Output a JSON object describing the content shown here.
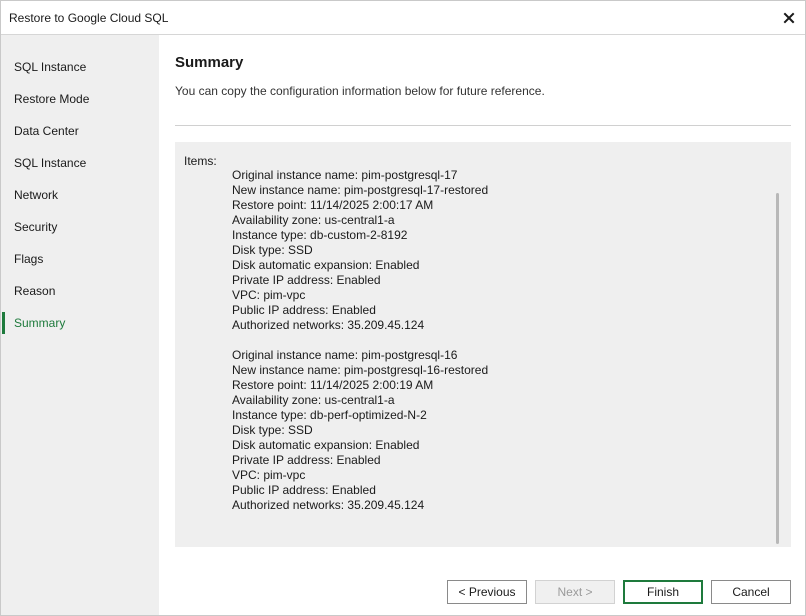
{
  "window": {
    "title": "Restore to Google Cloud SQL"
  },
  "sidebar": {
    "items": [
      {
        "label": "SQL Instance"
      },
      {
        "label": "Restore Mode"
      },
      {
        "label": "Data Center"
      },
      {
        "label": "SQL Instance"
      },
      {
        "label": "Network"
      },
      {
        "label": "Security"
      },
      {
        "label": "Flags"
      },
      {
        "label": "Reason"
      },
      {
        "label": "Summary"
      }
    ],
    "active_index": 8
  },
  "page": {
    "title": "Summary",
    "description": "You can copy the configuration information below for future reference."
  },
  "summary": {
    "items_label": "Items:",
    "instances": [
      {
        "lines": [
          "Original instance name: pim-postgresql-17",
          "New instance name: pim-postgresql-17-restored",
          "Restore point: 11/14/2025 2:00:17 AM",
          "Availability zone: us-central1-a",
          "Instance type: db-custom-2-8192",
          "Disk type: SSD",
          "Disk automatic expansion: Enabled",
          "Private IP address: Enabled",
          "VPC: pim-vpc",
          "Public IP address: Enabled",
          "Authorized networks: 35.209.45.124"
        ]
      },
      {
        "lines": [
          "Original instance name: pim-postgresql-16",
          "New instance name: pim-postgresql-16-restored",
          "Restore point: 11/14/2025 2:00:19 AM",
          "Availability zone: us-central1-a",
          "Instance type: db-perf-optimized-N-2",
          "Disk type: SSD",
          "Disk automatic expansion: Enabled",
          "Private IP address: Enabled",
          "VPC: pim-vpc",
          "Public IP address: Enabled",
          "Authorized networks: 35.209.45.124"
        ]
      }
    ]
  },
  "buttons": {
    "previous": "< Previous",
    "next": "Next >",
    "finish": "Finish",
    "cancel": "Cancel"
  },
  "colors": {
    "accent": "#1e7a3c",
    "sidebar_bg": "#efefef",
    "summary_bg": "#efefef"
  }
}
